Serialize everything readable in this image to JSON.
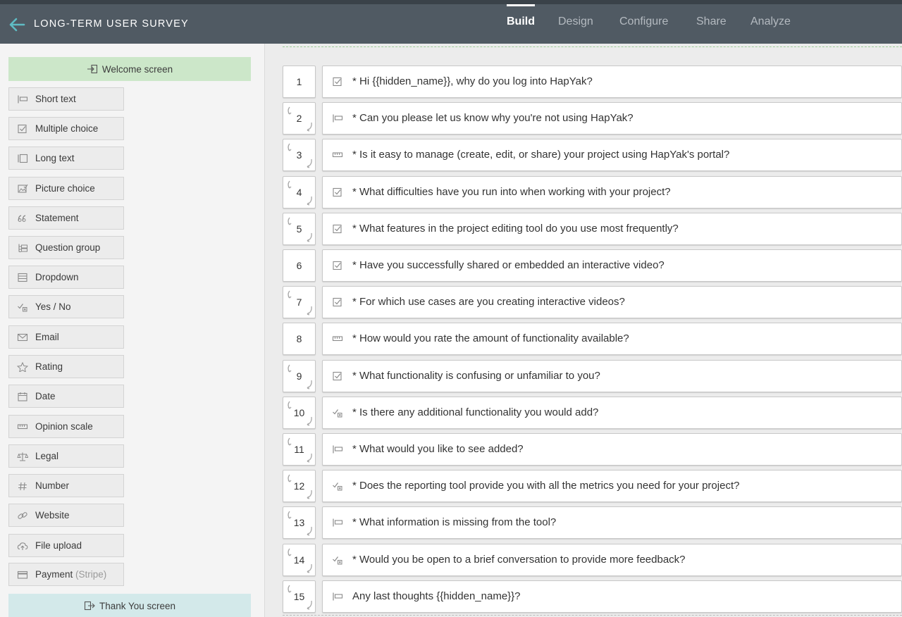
{
  "header": {
    "back_icon": "arrow-left-icon",
    "title": "LONG-TERM USER SURVEY",
    "tabs": [
      {
        "label": "Build",
        "active": true
      },
      {
        "label": "Design",
        "active": false
      },
      {
        "label": "Configure",
        "active": false
      },
      {
        "label": "Share",
        "active": false
      },
      {
        "label": "Analyze",
        "active": false
      }
    ]
  },
  "sidebar": {
    "welcome_label": "Welcome screen",
    "thank_you_label": "Thank You screen",
    "question_types": [
      {
        "label": "Short text",
        "icon": "short-text-icon"
      },
      {
        "label": "Multiple choice",
        "icon": "checkbox-icon"
      },
      {
        "label": "Long text",
        "icon": "long-text-icon"
      },
      {
        "label": "Picture choice",
        "icon": "picture-choice-icon"
      },
      {
        "label": "Statement",
        "icon": "quote-icon"
      },
      {
        "label": "Question group",
        "icon": "question-group-icon"
      },
      {
        "label": "Dropdown",
        "icon": "dropdown-icon"
      },
      {
        "label": "Yes / No",
        "icon": "yes-no-icon"
      },
      {
        "label": "Email",
        "icon": "envelope-icon"
      },
      {
        "label": "Rating",
        "icon": "star-icon"
      },
      {
        "label": "Date",
        "icon": "calendar-icon"
      },
      {
        "label": "Opinion scale",
        "icon": "scale-icon"
      },
      {
        "label": "Legal",
        "icon": "legal-scales-icon"
      },
      {
        "label": "Number",
        "icon": "hash-icon"
      },
      {
        "label": "Website",
        "icon": "link-icon"
      },
      {
        "label": "File upload",
        "icon": "cloud-upload-icon"
      },
      {
        "label": "Payment",
        "suffix": "(Stripe)",
        "icon": "credit-card-icon"
      }
    ]
  },
  "questions": [
    {
      "number": "1",
      "text": "* Hi {{hidden_name}}, why do you log into HapYak?",
      "icon": "checkbox-icon",
      "jump": false
    },
    {
      "number": "2",
      "text": "* Can you please let us know why you're not using HapYak?",
      "icon": "short-text-icon",
      "jump": true
    },
    {
      "number": "3",
      "text": "* Is it easy to manage (create, edit, or share) your project using HapYak's portal?",
      "icon": "scale-icon",
      "jump": true
    },
    {
      "number": "4",
      "text": "* What difficulties have you run into when working with your project?",
      "icon": "checkbox-icon",
      "jump": true
    },
    {
      "number": "5",
      "text": "* What features in the project editing tool do you use most frequently?",
      "icon": "checkbox-icon",
      "jump": true
    },
    {
      "number": "6",
      "text": "* Have you successfully shared or embedded an interactive video?",
      "icon": "checkbox-icon",
      "jump": false
    },
    {
      "number": "7",
      "text": "* For which use cases are you creating interactive videos?",
      "icon": "checkbox-icon",
      "jump": true
    },
    {
      "number": "8",
      "text": "* How would you rate the amount of functionality available?",
      "icon": "scale-icon",
      "jump": false
    },
    {
      "number": "9",
      "text": "* What functionality is confusing or unfamiliar to you?",
      "icon": "checkbox-icon",
      "jump": true
    },
    {
      "number": "10",
      "text": "* Is there any additional functionality you would add?",
      "icon": "yes-no-icon",
      "jump": true
    },
    {
      "number": "11",
      "text": "* What would you like to see added?",
      "icon": "short-text-icon",
      "jump": true
    },
    {
      "number": "12",
      "text": "* Does the reporting tool provide you with all the metrics you need for your project?",
      "icon": "yes-no-icon",
      "jump": true
    },
    {
      "number": "13",
      "text": "* What information is missing from the tool?",
      "icon": "short-text-icon",
      "jump": true
    },
    {
      "number": "14",
      "text": "* Would you be open to a brief conversation to provide more feedback?",
      "icon": "yes-no-icon",
      "jump": true
    },
    {
      "number": "15",
      "text": "Any last thoughts {{hidden_name}}?",
      "icon": "short-text-icon",
      "jump": true
    }
  ]
}
